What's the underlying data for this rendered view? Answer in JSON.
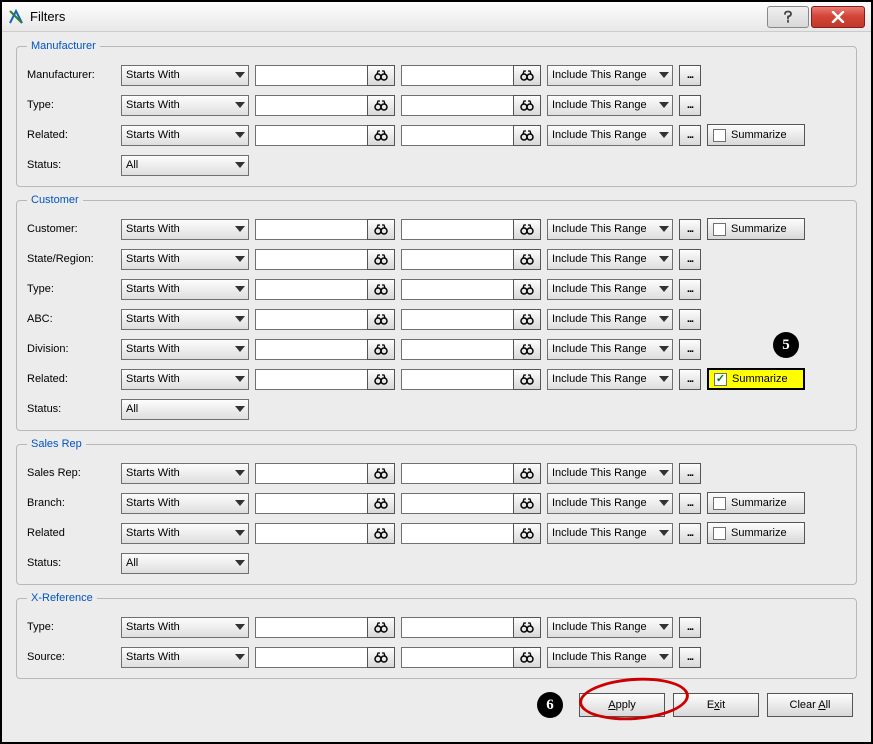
{
  "window": {
    "title": "Filters"
  },
  "labels": {
    "starts_with": "Starts With",
    "include_range": "Include This Range",
    "all": "All",
    "summarize": "Summarize",
    "ellipsis": "..."
  },
  "groups": {
    "manufacturer": {
      "legend": "Manufacturer",
      "rows": {
        "manufacturer": "Manufacturer:",
        "type": "Type:",
        "related": "Related:",
        "status": "Status:"
      }
    },
    "customer": {
      "legend": "Customer",
      "rows": {
        "customer": "Customer:",
        "state": "State/Region:",
        "type": "Type:",
        "abc": "ABC:",
        "division": "Division:",
        "related": "Related:",
        "status": "Status:"
      }
    },
    "salesrep": {
      "legend": "Sales Rep",
      "rows": {
        "salesrep": "Sales Rep:",
        "branch": "Branch:",
        "related": "Related",
        "status": "Status:"
      }
    },
    "xref": {
      "legend": "X-Reference",
      "rows": {
        "type": "Type:",
        "source": "Source:"
      }
    }
  },
  "buttons": {
    "apply": "Apply",
    "exit": "Exit",
    "clearall": "Clear All"
  },
  "callouts": {
    "five": "5",
    "six": "6"
  }
}
